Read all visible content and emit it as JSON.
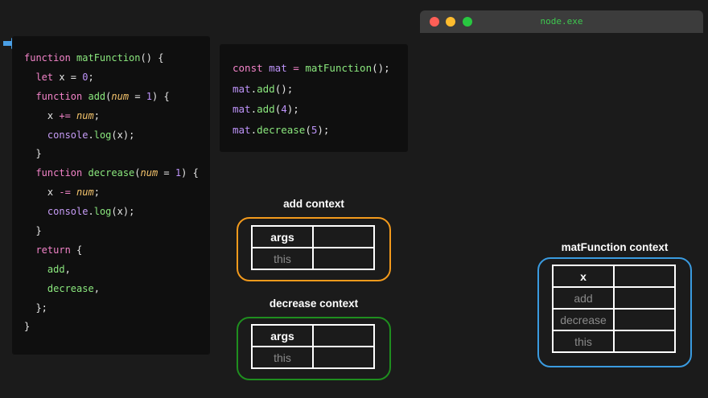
{
  "colors": {
    "background": "#1b1b1b",
    "code_bg": "#0f0f0f",
    "keyword": "#f283c8",
    "function_name": "#8be87e",
    "number": "#bd93f9",
    "parameter": "#f5c46c",
    "add_context_border": "#f39a1c",
    "decrease_context_border": "#1f8e1f",
    "matfunction_context_border": "#3a9be0",
    "terminal_title": "#3ec94f"
  },
  "icons": {
    "current_line": "arrow-right-icon"
  },
  "code_lines": [
    [
      {
        "t": "function ",
        "c": "kw"
      },
      {
        "t": "matFunction",
        "c": "fn"
      },
      {
        "t": "() {",
        "c": "plain"
      }
    ],
    [
      {
        "t": "  let ",
        "c": "kw"
      },
      {
        "t": "x = ",
        "c": "plain"
      },
      {
        "t": "0",
        "c": "num"
      },
      {
        "t": ";",
        "c": "plain"
      }
    ],
    [
      {
        "t": "  function ",
        "c": "kw"
      },
      {
        "t": "add",
        "c": "fn"
      },
      {
        "t": "(",
        "c": "plain"
      },
      {
        "t": "num",
        "c": "param"
      },
      {
        "t": " = ",
        "c": "plain"
      },
      {
        "t": "1",
        "c": "num"
      },
      {
        "t": ") {",
        "c": "plain"
      }
    ],
    [
      {
        "t": "    x ",
        "c": "plain"
      },
      {
        "t": "+=",
        "c": "kw"
      },
      {
        "t": " ",
        "c": "plain"
      },
      {
        "t": "num",
        "c": "param"
      },
      {
        "t": ";",
        "c": "plain"
      }
    ],
    [
      {
        "t": "    console",
        "c": "obj"
      },
      {
        "t": ".",
        "c": "plain"
      },
      {
        "t": "log",
        "c": "fn"
      },
      {
        "t": "(x);",
        "c": "plain"
      }
    ],
    [
      {
        "t": "  }",
        "c": "plain"
      }
    ],
    [
      {
        "t": "  function ",
        "c": "kw"
      },
      {
        "t": "decrease",
        "c": "fn"
      },
      {
        "t": "(",
        "c": "plain"
      },
      {
        "t": "num",
        "c": "param"
      },
      {
        "t": " = ",
        "c": "plain"
      },
      {
        "t": "1",
        "c": "num"
      },
      {
        "t": ") {",
        "c": "plain"
      }
    ],
    [
      {
        "t": "    x ",
        "c": "plain"
      },
      {
        "t": "-=",
        "c": "kw"
      },
      {
        "t": " ",
        "c": "plain"
      },
      {
        "t": "num",
        "c": "param"
      },
      {
        "t": ";",
        "c": "plain"
      }
    ],
    [
      {
        "t": "    console",
        "c": "obj"
      },
      {
        "t": ".",
        "c": "plain"
      },
      {
        "t": "log",
        "c": "fn"
      },
      {
        "t": "(x);",
        "c": "plain"
      }
    ],
    [
      {
        "t": "  }",
        "c": "plain"
      }
    ],
    [
      {
        "t": "  return ",
        "c": "kw"
      },
      {
        "t": "{",
        "c": "plain"
      }
    ],
    [
      {
        "t": "    add",
        "c": "fn"
      },
      {
        "t": ",",
        "c": "plain"
      }
    ],
    [
      {
        "t": "    decrease",
        "c": "fn"
      },
      {
        "t": ",",
        "c": "plain"
      }
    ],
    [
      {
        "t": "  };",
        "c": "plain"
      }
    ],
    [
      {
        "t": "}",
        "c": "plain"
      }
    ]
  ],
  "usage_lines": [
    [
      {
        "t": "const ",
        "c": "kw"
      },
      {
        "t": "mat",
        "c": "var"
      },
      {
        "t": " = ",
        "c": "kw"
      },
      {
        "t": "matFunction",
        "c": "fn"
      },
      {
        "t": "();",
        "c": "plain"
      }
    ],
    [
      {
        "t": "mat",
        "c": "var"
      },
      {
        "t": ".",
        "c": "plain"
      },
      {
        "t": "add",
        "c": "fn"
      },
      {
        "t": "();",
        "c": "plain"
      }
    ],
    [
      {
        "t": "mat",
        "c": "var"
      },
      {
        "t": ".",
        "c": "plain"
      },
      {
        "t": "add",
        "c": "fn"
      },
      {
        "t": "(",
        "c": "plain"
      },
      {
        "t": "4",
        "c": "num"
      },
      {
        "t": ");",
        "c": "plain"
      }
    ],
    [
      {
        "t": "mat",
        "c": "var"
      },
      {
        "t": ".",
        "c": "plain"
      },
      {
        "t": "decrease",
        "c": "fn"
      },
      {
        "t": "(",
        "c": "plain"
      },
      {
        "t": "5",
        "c": "num"
      },
      {
        "t": ");",
        "c": "plain"
      }
    ]
  ],
  "terminal": {
    "title": "node.exe"
  },
  "contexts": {
    "add": {
      "title": "add context",
      "rows": [
        {
          "key": "args",
          "active": true
        },
        {
          "key": "this",
          "active": false
        }
      ]
    },
    "decrease": {
      "title": "decrease context",
      "rows": [
        {
          "key": "args",
          "active": true
        },
        {
          "key": "this",
          "active": false
        }
      ]
    },
    "matFunction": {
      "title": "matFunction context",
      "rows": [
        {
          "key": "x",
          "active": true
        },
        {
          "key": "add",
          "active": false
        },
        {
          "key": "decrease",
          "active": false
        },
        {
          "key": "this",
          "active": false
        }
      ]
    }
  }
}
